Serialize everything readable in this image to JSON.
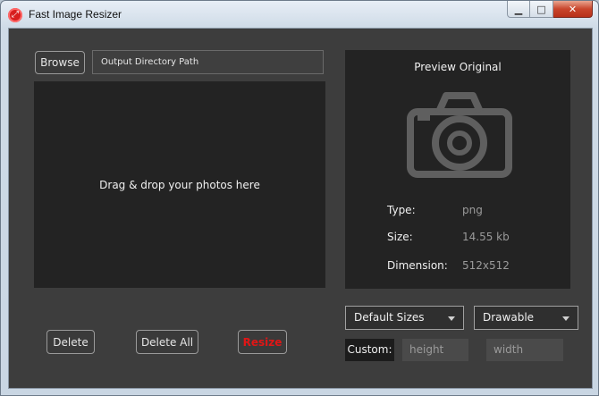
{
  "window": {
    "title": "Fast Image Resizer",
    "controls": {
      "minimize": "▁",
      "maximize": "□",
      "close": "✕"
    }
  },
  "toolbar": {
    "browse_label": "Browse",
    "output_path": "Output Directory Path"
  },
  "drop_zone": {
    "text": "Drag & drop your photos here"
  },
  "preview": {
    "title": "Preview Original",
    "icon": "camera-icon",
    "info": [
      {
        "label": "Type:",
        "value": "png"
      },
      {
        "label": "Size:",
        "value": "14.55 kb"
      },
      {
        "label": "Dimension:",
        "value": "512x512"
      }
    ]
  },
  "actions": {
    "delete_label": "Delete",
    "delete_all_label": "Delete All",
    "resize_label": "Resize"
  },
  "options": {
    "size_preset": "Default Sizes",
    "target": "Drawable",
    "custom_label": "Custom:",
    "height_placeholder": "height",
    "width_placeholder": "width"
  },
  "colors": {
    "background": "#3d3d3d",
    "panel": "#232323",
    "resize_accent": "#e01616",
    "close_button": "#c9462c"
  }
}
